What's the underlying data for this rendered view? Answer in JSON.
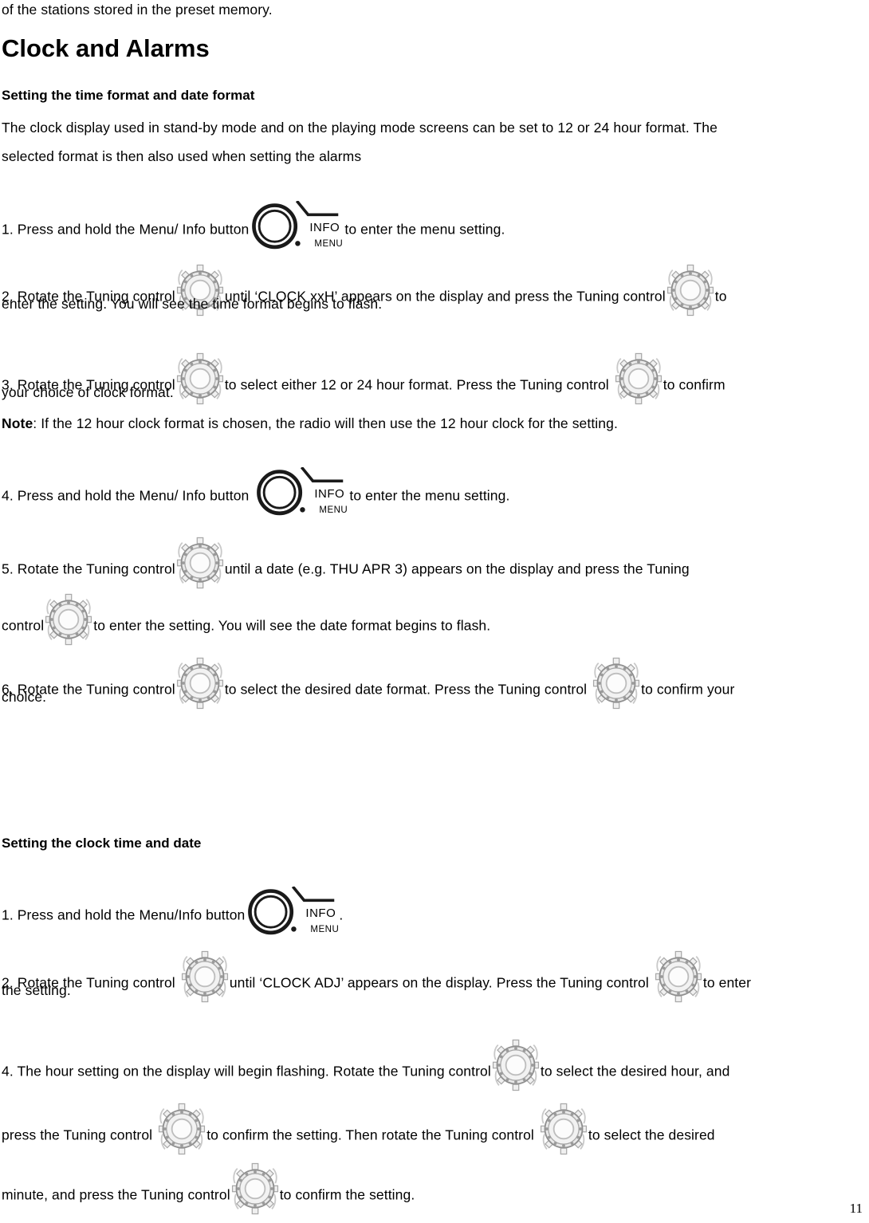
{
  "document": {
    "page_number": "11",
    "title": "Clock and Alarms"
  },
  "content": {
    "carryover_line": "of the stations stored in the preset memory.",
    "heading_main": "Clock and Alarms",
    "section1": {
      "heading": "Setting the time format and date format",
      "intro_line1": "The clock display used in stand-by mode and on the playing mode screens can be set to 12 or 24 hour format. The",
      "intro_line2": "selected format is then also used when setting the alarms",
      "step1_a": "1. Press and hold the Menu/ Info button",
      "step1_b": "to enter the menu setting.",
      "step2_a": "2. Rotate the Tuning control",
      "step2_b": "until ‘CLOCK xxH’ appears on the display and press the Tuning control",
      "step2_c": "to",
      "step2_line2": "enter the setting. You will see the time format begins to flash.",
      "step3_a": "3. Rotate the Tuning control",
      "step3_b": "to select either 12 or 24 hour format. Press the Tuning control",
      "step3_c": "to confirm",
      "step3_line2": "your choice of clock format.",
      "note_label": "Note",
      "note_text": ": If the 12 hour clock format is chosen, the radio will then use the 12 hour clock for the setting.",
      "step4_a": "4. Press and hold the Menu/ Info button",
      "step4_b": "to enter the menu setting.",
      "step5_a": "5. Rotate the Tuning control",
      "step5_b": "until a date (e.g. THU APR 3) appears on the display and press the Tuning",
      "step5_line2_a": "control",
      "step5_line2_b": "to enter the setting. You will see the date format begins to flash.",
      "step6_a": "6. Rotate the Tuning control",
      "step6_b": "to select the desired date format. Press the Tuning control",
      "step6_c": "to confirm your",
      "step6_line2": "choice."
    },
    "section2": {
      "heading": "Setting the clock time and date",
      "step1_a": "1. Press and hold the Menu/Info button",
      "step1_b": ".",
      "step2_a": "2. Rotate the Tuning control",
      "step2_b": "until ‘CLOCK ADJ’ appears on the display. Press the Tuning control",
      "step2_c": "to enter",
      "step2_line2": "the setting.",
      "step4_a": "4. The hour setting on the display will begin flashing. Rotate the Tuning control",
      "step4_b": "to select the desired hour, and",
      "step4_line2_a": "press the Tuning control",
      "step4_line2_b": "to confirm the setting. Then rotate the Tuning control",
      "step4_line2_c": "to select the desired",
      "step4_line3_a": "minute, and press the Tuning control",
      "step4_line3_b": "to confirm the setting."
    }
  },
  "icons": {
    "tuning_knob": "tuning-knob-icon",
    "info_menu_button": "info-menu-button-icon",
    "info_label": "INFO",
    "menu_label": "MENU"
  },
  "colors": {
    "text": "#000000",
    "background": "#ffffff",
    "knob_stroke": "#9a9a9a",
    "knob_fill": "#e6e6e6",
    "knob_light": "#f4f4f4",
    "bracket": "#cfcfcf"
  }
}
